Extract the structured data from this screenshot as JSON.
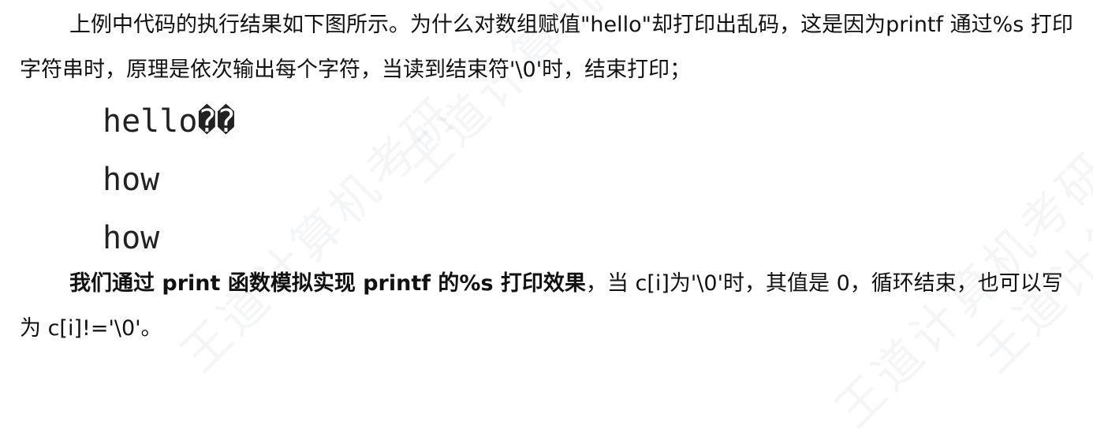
{
  "paragraph1": {
    "text": "上例中代码的执行结果如下图所示。为什么对数组赋值\"hello\"却打印出乱码，这是因为printf 通过%s 打印字符串时，原理是依次输出每个字符，当读到结束符'\\0'时，结束打印；"
  },
  "code_output": {
    "line1": "hello�\u0003�",
    "line2": "how",
    "line3": "how"
  },
  "paragraph2": {
    "bold_text": "我们通过 print 函数模拟实现 printf 的%s 打印效果",
    "rest_text": "，当 c[i]为'\\0'时，其值是 0，循环结束，也可以写为 c[i]!='\\0'。"
  },
  "watermark": {
    "text": "王道计算机考研"
  }
}
